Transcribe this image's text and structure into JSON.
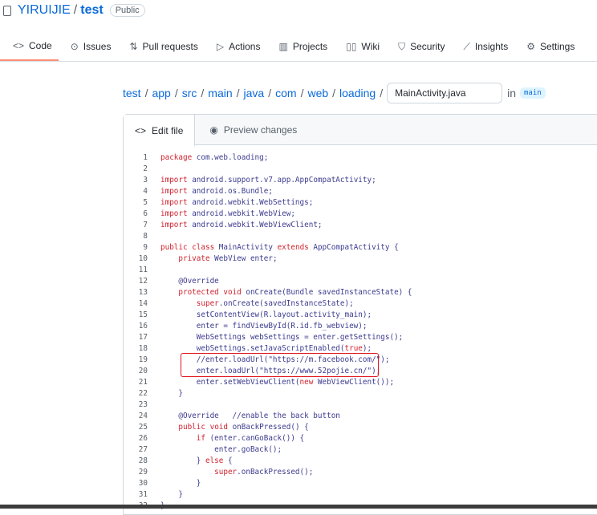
{
  "repo": {
    "owner": "YIRUIJIE",
    "name": "test",
    "visibility": "Public"
  },
  "nav": [
    {
      "label": "Code",
      "icon": "code-icon",
      "glyph": "<>"
    },
    {
      "label": "Issues",
      "icon": "issue-icon",
      "glyph": "⊙"
    },
    {
      "label": "Pull requests",
      "icon": "pull-request-icon",
      "glyph": "⇅"
    },
    {
      "label": "Actions",
      "icon": "play-icon",
      "glyph": "▷"
    },
    {
      "label": "Projects",
      "icon": "project-icon",
      "glyph": "▥"
    },
    {
      "label": "Wiki",
      "icon": "book-icon",
      "glyph": "▯▯"
    },
    {
      "label": "Security",
      "icon": "shield-icon",
      "glyph": "⛉"
    },
    {
      "label": "Insights",
      "icon": "graph-icon",
      "glyph": "⟋"
    },
    {
      "label": "Settings",
      "icon": "gear-icon",
      "glyph": "⚙"
    }
  ],
  "breadcrumb": [
    "test",
    "app",
    "src",
    "main",
    "java",
    "com",
    "web",
    "loading"
  ],
  "filename": "MainActivity.java",
  "in_label": "in",
  "branch": "main",
  "tabs": {
    "edit": "Edit file",
    "preview": "Preview changes"
  },
  "colors": {
    "keyword": "#cf222e",
    "text": "#3b3b8f",
    "highlight_box": "#e0141e",
    "accent": "#0969da"
  },
  "code": [
    "package com.web.loading;",
    "",
    "import android.support.v7.app.AppCompatActivity;",
    "import android.os.Bundle;",
    "import android.webkit.WebSettings;",
    "import android.webkit.WebView;",
    "import android.webkit.WebViewClient;",
    "",
    "public class MainActivity extends AppCompatActivity {",
    "    private WebView enter;",
    "",
    "    @Override",
    "    protected void onCreate(Bundle savedInstanceState) {",
    "        super.onCreate(savedInstanceState);",
    "        setContentView(R.layout.activity_main);",
    "        enter = findViewById(R.id.fb_webview);",
    "        WebSettings webSettings = enter.getSettings();",
    "        webSettings.setJavaScriptEnabled(true);",
    "        //enter.loadUrl(\"https://m.facebook.com/\");",
    "        enter.loadUrl(\"https://www.52pojie.cn/\");",
    "        enter.setWebViewClient(new WebViewClient());",
    "    }",
    "",
    "    @Override   //enable the back button",
    "    public void onBackPressed() {",
    "        if (enter.canGoBack()) {",
    "            enter.goBack();",
    "        } else {",
    "            super.onBackPressed();",
    "        }",
    "    }",
    "}"
  ]
}
